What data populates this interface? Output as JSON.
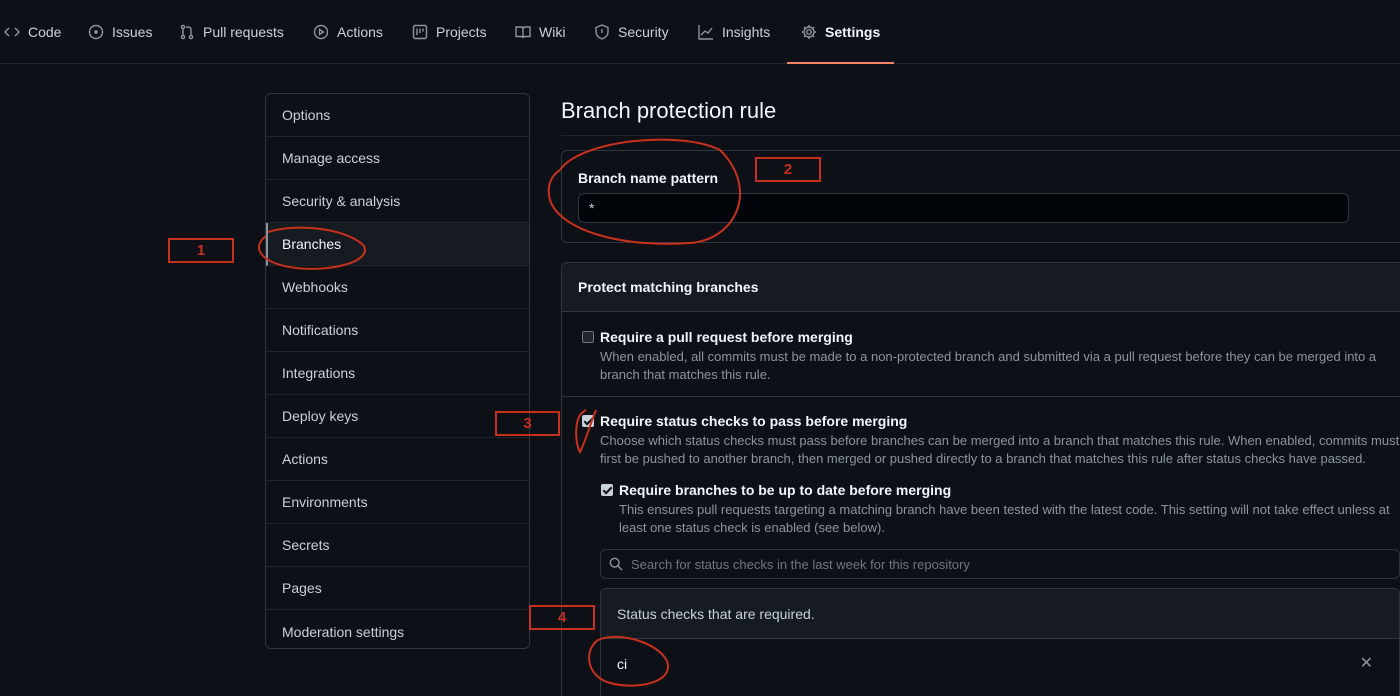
{
  "nav": {
    "tabs": [
      {
        "label": "Code",
        "icon": "code-icon"
      },
      {
        "label": "Issues",
        "icon": "issue-icon"
      },
      {
        "label": "Pull requests",
        "icon": "pull-request-icon"
      },
      {
        "label": "Actions",
        "icon": "play-icon"
      },
      {
        "label": "Projects",
        "icon": "project-icon"
      },
      {
        "label": "Wiki",
        "icon": "book-icon"
      },
      {
        "label": "Security",
        "icon": "shield-icon"
      },
      {
        "label": "Insights",
        "icon": "graph-icon"
      },
      {
        "label": "Settings",
        "icon": "gear-icon"
      }
    ],
    "active": "Settings"
  },
  "sidebar": {
    "items": [
      {
        "label": "Options"
      },
      {
        "label": "Manage access"
      },
      {
        "label": "Security & analysis"
      },
      {
        "label": "Branches"
      },
      {
        "label": "Webhooks"
      },
      {
        "label": "Notifications"
      },
      {
        "label": "Integrations"
      },
      {
        "label": "Deploy keys"
      },
      {
        "label": "Actions"
      },
      {
        "label": "Environments"
      },
      {
        "label": "Secrets"
      },
      {
        "label": "Pages"
      },
      {
        "label": "Moderation settings"
      }
    ],
    "selected": "Branches"
  },
  "main": {
    "title": "Branch protection rule",
    "pattern": {
      "label": "Branch name pattern",
      "value": "*"
    },
    "protect": {
      "heading": "Protect matching branches",
      "rules": [
        {
          "title": "Require a pull request before merging",
          "description": "When enabled, all commits must be made to a non-protected branch and submitted via a pull request before they can be merged into a branch that matches this rule.",
          "checked": false
        },
        {
          "title": "Require status checks to pass before merging",
          "description": "Choose which status checks must pass before branches can be merged into a branch that matches this rule. When enabled, commits must first be pushed to another branch, then merged or pushed directly to a branch that matches this rule after status checks have passed.",
          "checked": true
        },
        {
          "title": "Require branches to be up to date before merging",
          "description": "This ensures pull requests targeting a matching branch have been tested with the latest code. This setting will not take effect unless at least one status check is enabled (see below).",
          "checked": true
        }
      ],
      "search_placeholder": "Search for status checks in the last week for this repository",
      "required_heading": "Status checks that are required.",
      "required_checks": [
        "ci"
      ],
      "remove_glyph": "✕"
    }
  },
  "annotations": {
    "color": "#c8301e",
    "labels": [
      "1",
      "2",
      "3",
      "4"
    ]
  }
}
